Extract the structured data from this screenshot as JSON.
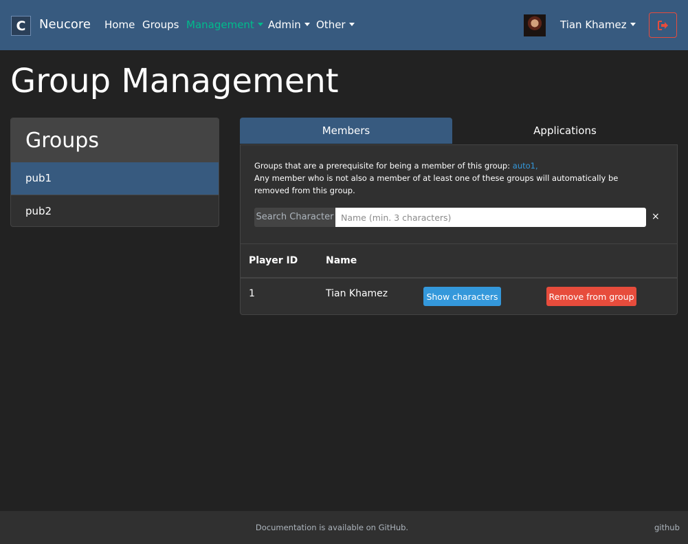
{
  "navbar": {
    "logo_letter": "C",
    "brand": "Neucore",
    "items": [
      {
        "label": "Home"
      },
      {
        "label": "Groups"
      },
      {
        "label": "Management"
      },
      {
        "label": "Admin"
      },
      {
        "label": "Other"
      }
    ],
    "active_item": "Management",
    "user_name": "Tian Khamez",
    "logout_icon": "sign-out-icon"
  },
  "page_title": "Group Management",
  "groups_card": {
    "title": "Groups",
    "items": [
      {
        "label": "pub1",
        "active": true
      },
      {
        "label": "pub2",
        "active": false
      }
    ]
  },
  "tabs": [
    {
      "label": "Members",
      "active": true
    },
    {
      "label": "Applications",
      "active": false
    }
  ],
  "members": {
    "notice_prefix": "Groups that are a prerequisite for being a member of this group:",
    "notice_link": "auto1,",
    "notice_body": "Any member who is not also a member of at least one of these groups will automatically be removed from this group.",
    "search_label": "Search Character",
    "search_placeholder": "Name (min. 3 characters)",
    "search_value": "",
    "clear_symbol": "×",
    "columns": [
      "Player ID",
      "Name"
    ],
    "rows": [
      {
        "id": "1",
        "name": "Tian Khamez",
        "show_label": "Show characters",
        "remove_label": "Remove from group"
      }
    ]
  },
  "footer": {
    "text": "Documentation is available on GitHub.",
    "link": "github"
  },
  "colors": {
    "navbar": "#375a7f",
    "background": "#222222",
    "accent_active": "#00bc8c",
    "info": "#3498db",
    "danger": "#e74c3c"
  }
}
